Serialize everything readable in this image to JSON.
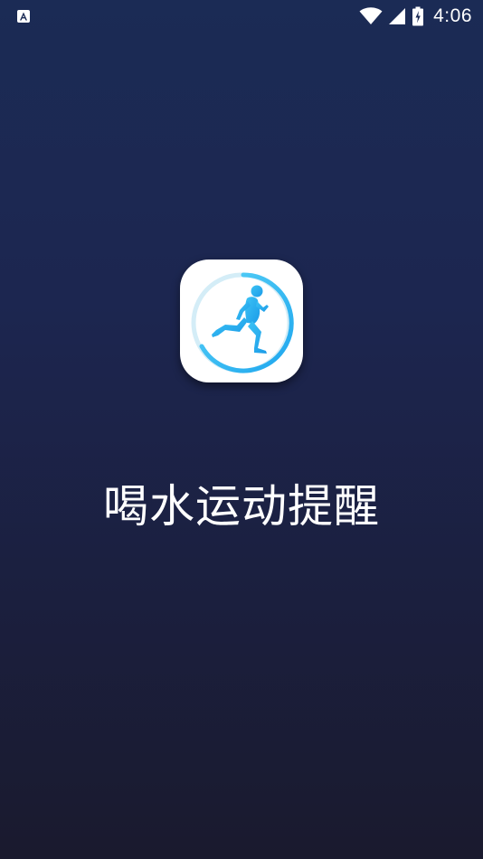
{
  "status_bar": {
    "time": "4:06",
    "notification_icon": "app-notification-icon",
    "wifi_icon": "wifi-icon",
    "signal_icon": "cell-signal-icon",
    "battery_icon": "battery-charging-icon",
    "color": "#ffffff"
  },
  "splash": {
    "app_icon": "running-man-icon",
    "app_name": "喝水运动提醒",
    "colors": {
      "background_top": "#1b2b55",
      "background_bottom": "#1a1a2e",
      "icon_accent": "#2bb4f0"
    }
  }
}
